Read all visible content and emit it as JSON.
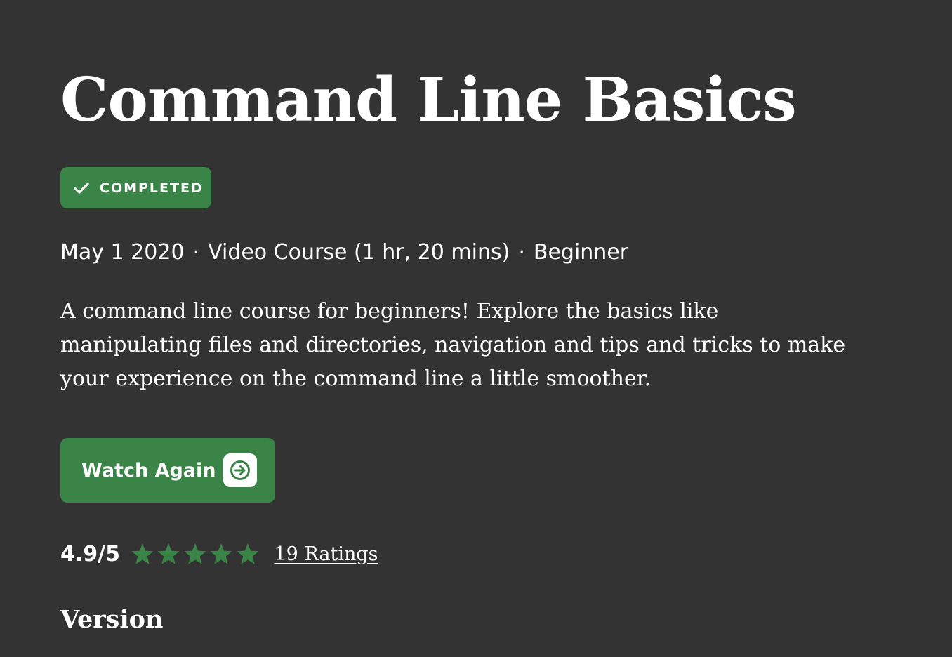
{
  "course": {
    "title": "Command Line Basics",
    "status_badge": "COMPLETED",
    "meta": {
      "date": "May 1 2020",
      "separator": "·",
      "format": "Video Course (1 hr, 20 mins)",
      "level": "Beginner"
    },
    "description": "A command line course for beginners! Explore the basics like manipulating files and directories, navigation and tips and tricks to make your experience on the command line a little smoother.",
    "primary_action": {
      "label": "Watch Again",
      "icon": "arrow-right-icon"
    },
    "rating": {
      "score": "4.9/5",
      "stars_filled": 5,
      "stars_total": 5,
      "ratings_link": "19 Ratings"
    },
    "next_section_heading": "Version"
  },
  "colors": {
    "background": "#333333",
    "accent_green": "#3a8447",
    "text": "#ffffff"
  }
}
